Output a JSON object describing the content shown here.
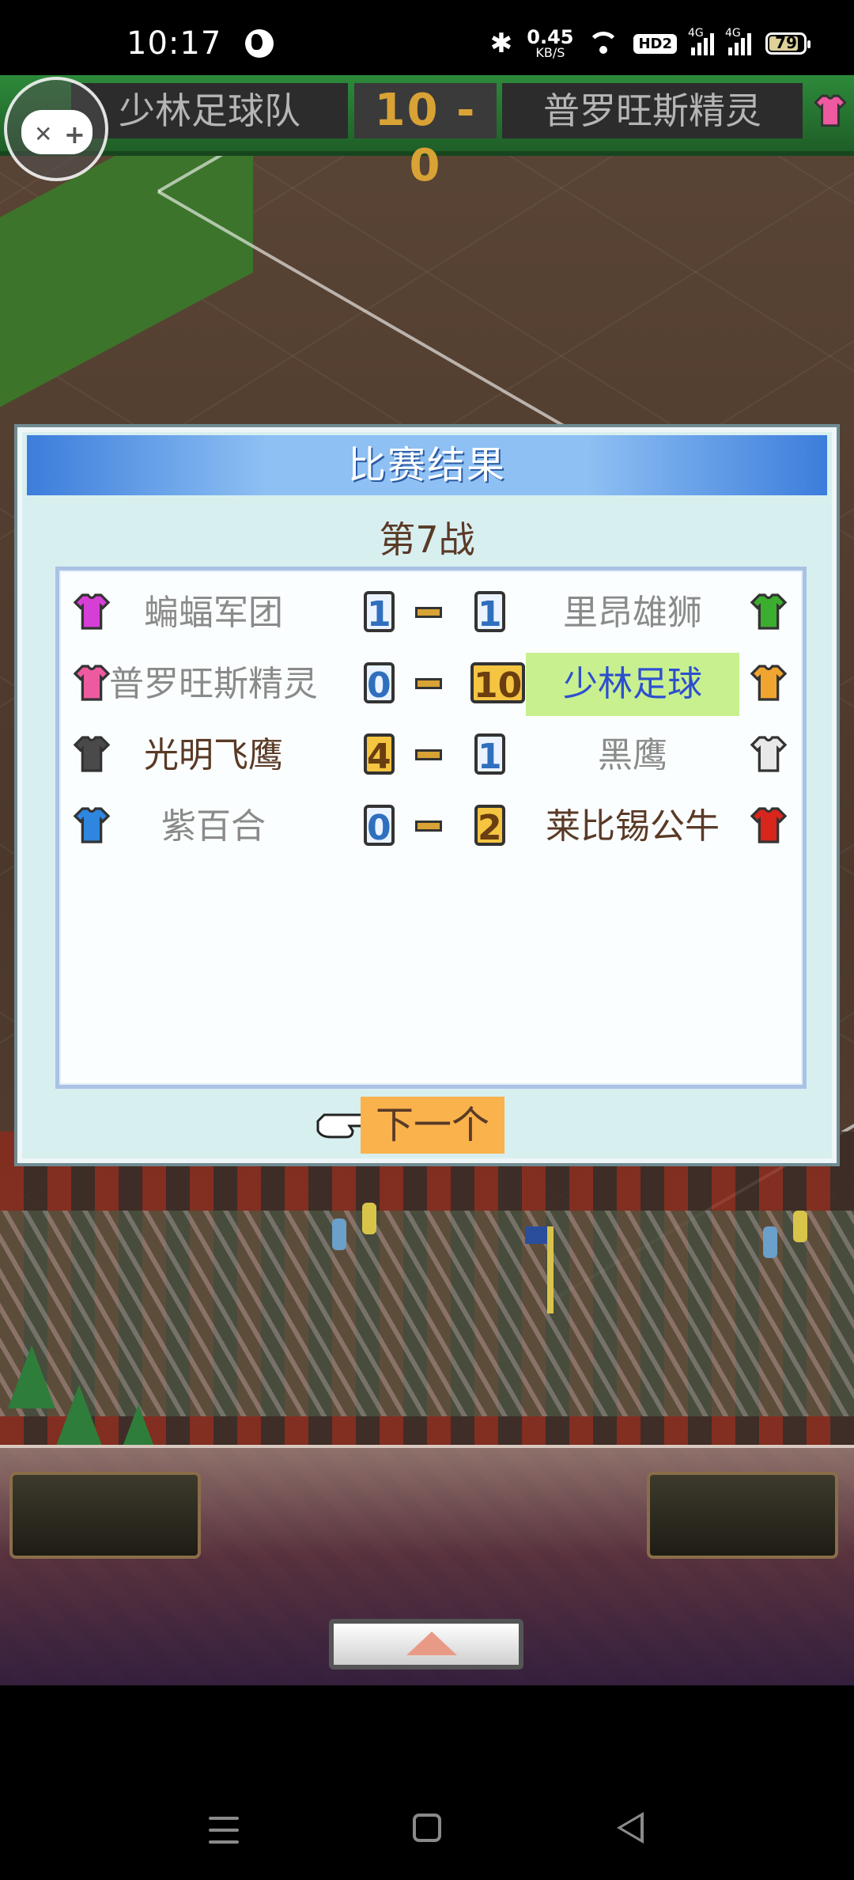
{
  "status_bar": {
    "time": "10:17",
    "net_speed_value": "0.45",
    "net_speed_unit": "KB/S",
    "hd_badge": "HD2",
    "signal_label_1": "4G",
    "signal_label_2": "4G",
    "battery": "79",
    "icons": [
      "globe-icon",
      "bluetooth-icon",
      "wifi-icon",
      "signal-icon",
      "battery-icon"
    ]
  },
  "scoreboard": {
    "home_team": "少林足球队",
    "score": "10 - 0",
    "away_team": "普罗旺斯精灵"
  },
  "dialog": {
    "title": "比赛结果",
    "round": "第7战",
    "results": [
      {
        "home": "蝙蝠军团",
        "home_color": "#d63fd6",
        "home_score": "1",
        "away_score": "1",
        "away": "里昂雄狮",
        "away_color": "#3cae2f",
        "home_win": false,
        "away_win": false,
        "highlight": false
      },
      {
        "home": "普罗旺斯精灵",
        "home_color": "#ee5aa0",
        "home_score": "0",
        "away_score": "10",
        "away": "少林足球",
        "away_color": "#f0a530",
        "home_win": false,
        "away_win": true,
        "highlight": true
      },
      {
        "home": "光明飞鹰",
        "home_color": "#4a4a4a",
        "home_score": "4",
        "away_score": "1",
        "away": "黑鹰",
        "away_color": "#e8e8e8",
        "home_win": true,
        "away_win": false,
        "highlight": false
      },
      {
        "home": "紫百合",
        "home_color": "#2e86e0",
        "home_score": "0",
        "away_score": "2",
        "away": "莱比锡公牛",
        "away_color": "#d9261c",
        "home_win": false,
        "away_win": true,
        "highlight": false
      }
    ],
    "next_button": "下一个"
  },
  "colors": {
    "header_blue": "#3c7ddc",
    "win_gold": "#f5c542",
    "highlight_green": "#c8f08f",
    "button_orange": "#f9b24c"
  }
}
